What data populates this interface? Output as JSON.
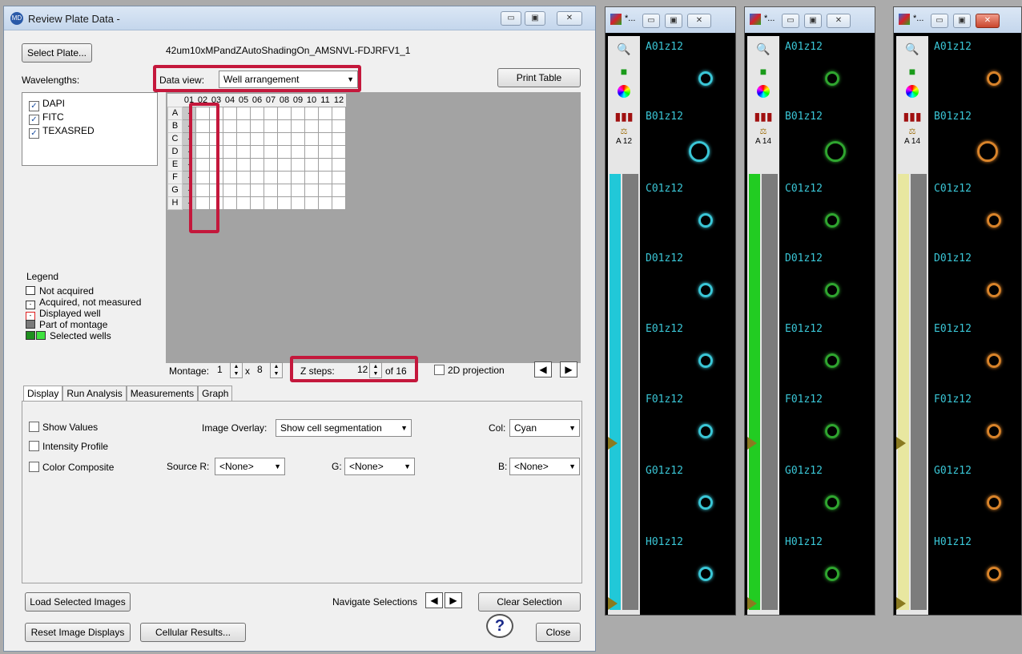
{
  "window": {
    "title": "Review Plate Data -",
    "plate_name": "42um10xMPandZAutoShadingOn_AMSNVL-FDJRFV1_1",
    "select_plate": "Select Plate...",
    "wavelengths_label": "Wavelengths:",
    "wavelengths": [
      "DAPI",
      "FITC",
      "TEXASRED"
    ],
    "data_view_label": "Data view:",
    "data_view_value": "Well arrangement",
    "print_table": "Print Table",
    "columns": [
      "01",
      "02",
      "03",
      "04",
      "05",
      "06",
      "07",
      "08",
      "09",
      "10",
      "11",
      "12"
    ],
    "rows": [
      "A",
      "B",
      "C",
      "D",
      "E",
      "F",
      "G",
      "H"
    ],
    "acquired_mark": "-",
    "legend": {
      "title": "Legend",
      "items": [
        "Not acquired",
        "Acquired, not measured",
        "Displayed well",
        "Part of montage",
        "Selected wells"
      ]
    },
    "montage_label": "Montage:",
    "montage_x": "1",
    "montage_by": "x",
    "montage_y": "8",
    "zsteps_label": "Z steps:",
    "zsteps_value": "12",
    "zsteps_of": "of 16",
    "projection_2d": "2D projection",
    "tabs": [
      "Display",
      "Run Analysis",
      "Measurements",
      "Graph"
    ],
    "show_values": "Show Values",
    "intensity_profile": "Intensity Profile",
    "color_composite": "Color Composite",
    "image_overlay_label": "Image Overlay:",
    "image_overlay_value": "Show cell segmentation",
    "col_label": "Col:",
    "col_value": "Cyan",
    "source_r_label": "Source R:",
    "source_r_value": "<None>",
    "g_label": "G:",
    "g_value": "<None>",
    "b_label": "B:",
    "b_value": "<None>",
    "load_selected": "Load Selected Images",
    "navigate_selections": "Navigate Selections",
    "clear_selection": "Clear Selection",
    "reset_displays": "Reset Image Displays",
    "cellular_results": "Cellular Results...",
    "close": "Close",
    "help_glyph": "?"
  },
  "image_windows": [
    {
      "title": "*...",
      "scale_label": "A 12",
      "color": "#3ac6d6",
      "bar_color": "#21c8d8"
    },
    {
      "title": "*...",
      "scale_label": "A 14",
      "color": "#2fa52f",
      "bar_color": "#22cc22"
    },
    {
      "title": "*...",
      "scale_label": "A 14",
      "color": "#d8832a",
      "bar_color": "#e8e7a0"
    }
  ],
  "well_labels": [
    "A01z12",
    "B01z12",
    "C01z12",
    "D01z12",
    "E01z12",
    "F01z12",
    "G01z12",
    "H01z12"
  ]
}
